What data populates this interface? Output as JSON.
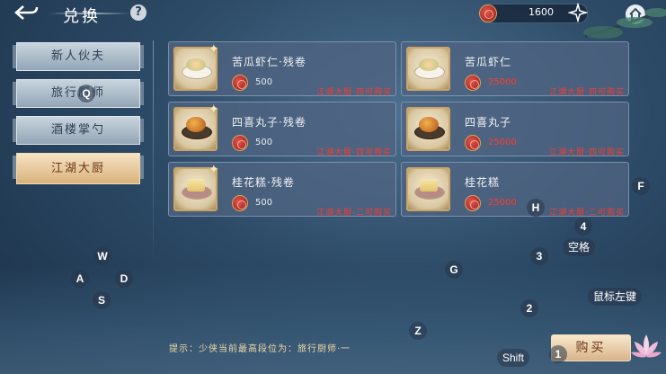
{
  "header": {
    "back_icon": "back-arrow-icon",
    "title": "兑换",
    "help_label": "?",
    "currency_value": "1600",
    "plus_icon": "plus-icon",
    "home_icon": "home-icon"
  },
  "tabs": [
    {
      "label": "新人伙夫",
      "active": false
    },
    {
      "label": "旅行厨师",
      "active": false
    },
    {
      "label": "酒楼掌勺",
      "active": false
    },
    {
      "label": "江湖大厨",
      "active": true
    }
  ],
  "items": [
    {
      "name": "苦瓜虾仁·残卷",
      "price": "500",
      "price_red": false,
      "requirement": "江湖大厨·四可购买",
      "food": "shrimp",
      "fragment": true
    },
    {
      "name": "苦瓜虾仁",
      "price": "25000",
      "price_red": true,
      "requirement": "江湖大厨·四可购买",
      "food": "shrimp",
      "fragment": false
    },
    {
      "name": "四喜丸子·残卷",
      "price": "500",
      "price_red": false,
      "requirement": "江湖大厨·四可购买",
      "food": "ball",
      "fragment": true
    },
    {
      "name": "四喜丸子",
      "price": "25000",
      "price_red": true,
      "requirement": "江湖大厨·四可购买",
      "food": "ball",
      "fragment": false
    },
    {
      "name": "桂花糕·残卷",
      "price": "500",
      "price_red": false,
      "requirement": "江湖大厨·二可购买",
      "food": "cake",
      "fragment": true
    },
    {
      "name": "桂花糕",
      "price": "25000",
      "price_red": true,
      "requirement": "江湖大厨·二可购买",
      "food": "cake",
      "fragment": false
    }
  ],
  "footer": {
    "tip": "提示：少侠当前最高段位为：旅行厨师·一",
    "buy_label": "购买"
  },
  "key_hints": {
    "q": "Q",
    "w": "W",
    "a": "A",
    "s": "S",
    "d": "D",
    "f": "F",
    "h": "H",
    "g": "G",
    "z": "Z",
    "four": "4",
    "three": "3",
    "two": "2",
    "one": "1",
    "space": "空格",
    "mouse_left": "鼠标左键",
    "shift": "Shift"
  },
  "colors": {
    "accent_red": "#ff3b2e",
    "active_tab": "#d9b27b",
    "tip_text": "#f1d9a6"
  }
}
